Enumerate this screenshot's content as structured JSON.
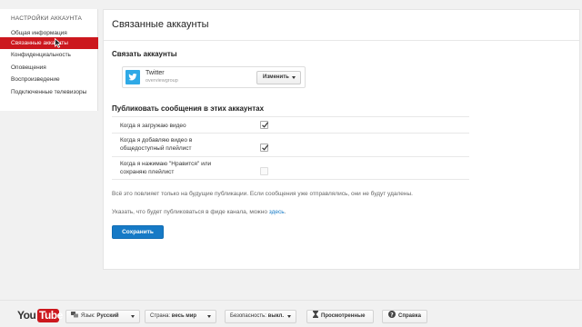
{
  "sidebar": {
    "title": "НАСТРОЙКИ АККАУНТА",
    "items": [
      {
        "label": "Общая информация"
      },
      {
        "label": "Связанные аккаунты"
      },
      {
        "label": "Конфиденциальность"
      },
      {
        "label": "Оповещения"
      },
      {
        "label": "Воспроизведение"
      },
      {
        "label": "Подключенные телевизоры"
      }
    ]
  },
  "main": {
    "title": "Связанные аккаунты",
    "link_section_title": "Связать аккаунты",
    "account": {
      "name": "Twitter",
      "handle": "overviewgroup",
      "change_label": "Изменить",
      "icon": "twitter-bird-icon",
      "brand_color": "#2fa9e6"
    },
    "publish_section_title": "Публиковать сообщения в этих аккаунтах",
    "preferences": [
      {
        "label": "Когда я загружаю видео",
        "checked": true,
        "disabled": false
      },
      {
        "label": "Когда я добавляю видео в общедоступный плейлист",
        "checked": true,
        "disabled": false
      },
      {
        "label": "Когда я нажимаю \"Нравится\" или сохраняю плейлист",
        "checked": false,
        "disabled": true
      }
    ],
    "notice": "Всё это повлияет только на будущие публикации. Если сообщения уже отправлялись, они не будут удалены.",
    "feed_text": "Указать, что будет публиковаться в фиде канала, можно",
    "feed_link": "здесь",
    "feed_end": ".",
    "save_label": "Сохранить"
  },
  "footer": {
    "logo_you": "You",
    "logo_tube": "Tube",
    "language_label": "Язык:",
    "language_value": "Русский",
    "country_label": "Страна:",
    "country_value": "весь мир",
    "safety_label": "Безопасность:",
    "safety_value": "выкл.",
    "history_label": "Просмотренные",
    "help_label": "Справка"
  },
  "colors": {
    "accent_red": "#cc181e",
    "link_blue": "#167ac6"
  }
}
